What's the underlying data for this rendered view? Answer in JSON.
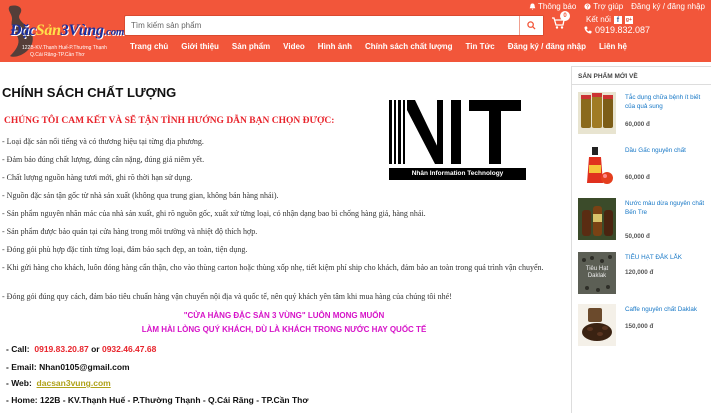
{
  "header": {
    "logo": {
      "part_a": "Đặc",
      "part_b": "Sản",
      "part_c": "3Vùng",
      "part_d": ".com",
      "address_line1": "122B-KV.Thạnh Huế-P.Thường Thạnh",
      "address_line2": "Q.Cái Răng-TP.Cần Thơ"
    },
    "search": {
      "placeholder": "Tìm kiếm sản phẩm"
    },
    "top_links": {
      "notifications": "Thông báo",
      "help": "Trợ giúp",
      "auth": "Đăng ký / đăng nhập"
    },
    "cart_count": "0",
    "connect_label": "Kết nối",
    "hotline": "0919.832.087",
    "nav": [
      "Trang chủ",
      "Giới thiệu",
      "Sản phẩm",
      "Video",
      "Hình ảnh",
      "Chính sách chất lượng",
      "Tin Tức",
      "Đăng ký / đăng nhập",
      "Liên hệ"
    ]
  },
  "main": {
    "title": "CHÍNH SÁCH CHẤT LƯỢNG",
    "intro": "CHÚNG TÔI CAM KẾT VÀ SẼ TẬN TÌNH HƯỚNG DẪN BẠN CHỌN ĐƯỢC:",
    "logo_letters": "NIT",
    "logo_caption": "Nhân Information Technology",
    "bullets": [
      "- Loại đặc sản nổi tiếng và có thương hiệu tại từng địa phương.",
      "- Đảm bảo đúng chất lượng, đúng cân nặng, đúng giá niêm yết.",
      "- Chất lượng nguồn hàng tươi mới, ghi rõ thời hạn sử dụng.",
      "- Nguồn đặc sản tận gốc từ nhà sản xuất (không qua trung gian, không bán hàng nhái).",
      "- Sản phẩm nguyên nhãn mác của nhà sản xuất, ghi rõ nguồn gốc, xuất xứ từng loại, có nhận dạng bao bì chống hàng giả, hàng nhái.",
      "- Sản phẩm được bảo quản tại cửa hàng trong môi trường và nhiệt độ thích hợp.",
      "- Đóng gói phù hợp đặc tính từng loại, đảm bảo sạch đẹp, an toàn, tiện dụng.",
      "- Khi gửi hàng cho khách, luôn đóng hàng cẩn thận, cho vào thùng carton hoặc thùng xốp nhẹ, tiết kiệm phí ship cho khách, đảm bảo an toàn trong quá trình vận chuyển.",
      "- Đóng gói đúng quy cách, đảm bảo tiêu chuẩn hàng vận chuyển nội địa và quốc tế, nên quý khách yên tâm khi mua hàng của chúng tôi nhé!"
    ],
    "slogan_1": "\"CỬA HÀNG ĐẶC SẢN 3 VÙNG\" LUÔN MONG MUỐN",
    "slogan_2": "LÀM HÀI LÒNG QUÝ KHÁCH, DÙ LÀ KHÁCH TRONG NƯỚC HAY QUỐC TẾ",
    "contact": {
      "call_label": "- Call:",
      "phone_1": "0919.83.20.87",
      "or": "or",
      "phone_2": "0932.46.47.68",
      "email_label": "- Email:",
      "email": "Nhan0105@gmail.com",
      "web_label": "- Web:",
      "web": "dacsan3vung.com",
      "home_label": "- Home:",
      "home": "122B - KV.Thạnh Huế - P.Thường Thạnh - Q.Cái Răng - TP.Cần Thơ"
    }
  },
  "sidebar": {
    "title": "SẢN PHẨM MỚI VỀ",
    "products": [
      {
        "name": "Tắc dụng chữa bệnh ít biết của quả sung",
        "price": "60,000 đ",
        "thumb": "jar-icon"
      },
      {
        "name": "Dầu Gấc nguyên chất",
        "price": "60,000 đ",
        "thumb": "bottle-icon"
      },
      {
        "name": "Nước màu dừa nguyên chất Bến Tre",
        "price": "50,000 đ",
        "thumb": "bottles-icon"
      },
      {
        "name": "TIÊU HẠT ĐẮK LẮK",
        "price": "120,000 đ",
        "thumb": "pepper-icon",
        "thumb_text": "Tiêu Hạt Daklak"
      },
      {
        "name": "Caffe nguyên chất Daklak",
        "price": "150,000 đ",
        "thumb": "coffee-icon"
      }
    ]
  },
  "colors": {
    "header_bg": "#f2563a",
    "red_text": "#e8242c",
    "magenta_text": "#d613c8",
    "link_blue": "#1677c6"
  }
}
